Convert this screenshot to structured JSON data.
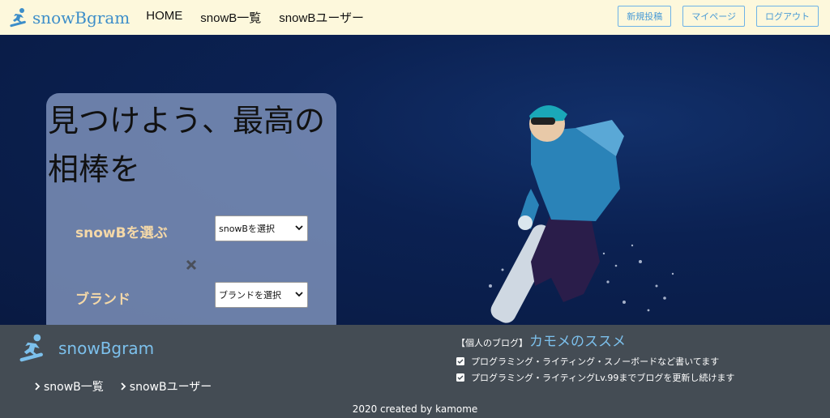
{
  "header": {
    "brand": "snowBgram",
    "nav": [
      "HOME",
      "snowB一覧",
      "snowBユーザー"
    ],
    "buttons": [
      "新規投稿",
      "マイページ",
      "ログアウト"
    ]
  },
  "hero": {
    "title": "見つけよう、最高の相棒を",
    "snowb_label": "snowBを選ぶ",
    "snowb_select": "snowBを選択",
    "brand_label": "ブランド",
    "brand_select": "ブランドを選択"
  },
  "footer": {
    "brand": "snowBgram",
    "links": [
      "snowB一覧",
      "snowBユーザー"
    ],
    "blog_prefix": "【個人のブログ】",
    "blog_name": "カモメのススメ",
    "blog_items": [
      "プログラミング・ライティング・スノーボードなど書いてます",
      "プログラミング・ライティングLv.99までブログを更新し続けます"
    ],
    "copyright": "2020 created by kamome"
  },
  "colors": {
    "header_bg": "#fdf8dc",
    "accent": "#3d8ec9",
    "footer_bg": "#444c54",
    "label": "#f4d8a8"
  },
  "icons": [
    "snowboarder-icon",
    "chevron-down-icon",
    "cross-icon",
    "chevron-right-icon",
    "check-square-icon"
  ]
}
